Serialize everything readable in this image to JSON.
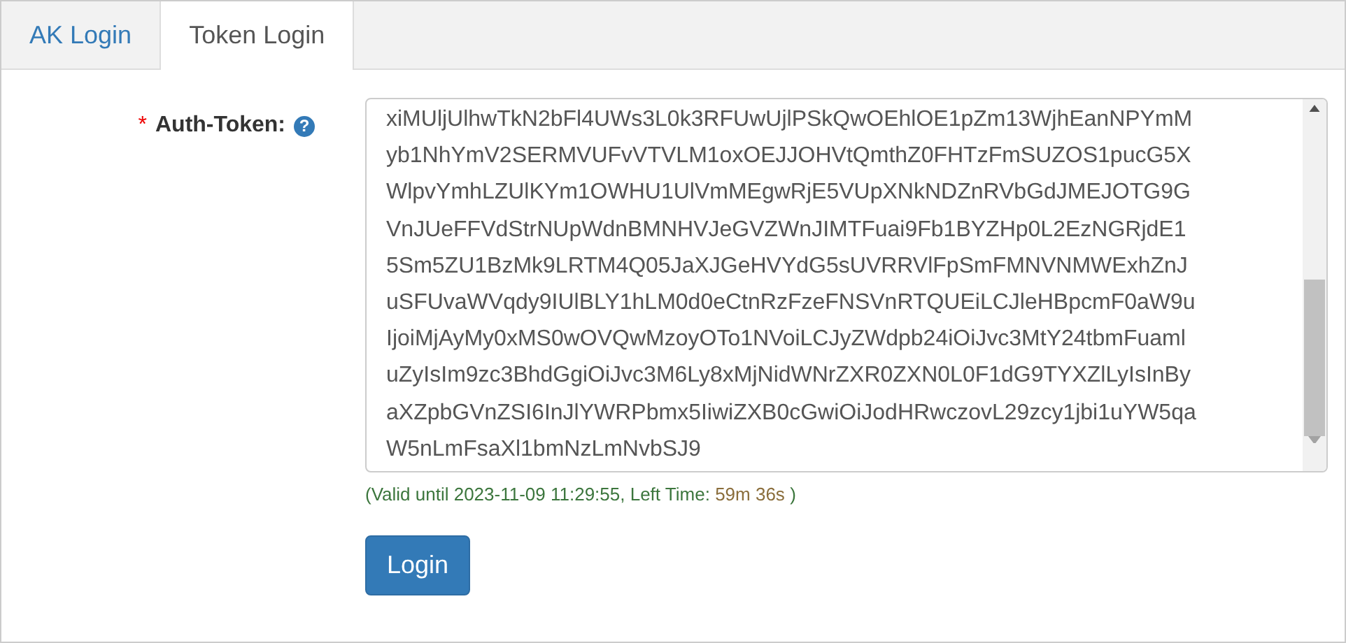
{
  "tabs": [
    {
      "label": "AK Login",
      "selected": false
    },
    {
      "label": "Token Login",
      "selected": true
    }
  ],
  "form": {
    "required_mark": "*",
    "label": "Auth-Token:",
    "help_icon": "?",
    "token_lines": [
      "xiMUljUlhwTkN2bFl4UWs3L0k3RFUwUjlPSkQwOEhlOE1pZm13WjhEanNPYmM",
      "yb1NhYmV2SERMVUFvVTVLM1oxOEJJOHVtQmthZ0FHTzFmSUZOS1pucG5X",
      "WlpvYmhLZUlKYm1OWHU1UlVmMEgwRjE5VUpXNkNDZnRVbGdJMEJOTG9G",
      "VnJUeFFVdStrNUpWdnBMNHVJeGVZWnJIMTFuai9Fb1BYZHp0L2EzNGRjdE1",
      "5Sm5ZU1BzMk9LRTM4Q05JaXJGeHVYdG5sUVRRVlFpSmFMNVNMWExhZnJ",
      "uSFUvaWVqdy9IUlBLY1hLM0d0eCtnRzFzeFNSVnRTQUEiLCJleHBpcmF0aW9u",
      "IjoiMjAyMy0xMS0wOVQwMzoyOTo1NVoiLCJyZWdpb24iOiJvc3MtY24tbmFuaml",
      "uZyIsIm9zc3BhdGgiOiJvc3M6Ly8xMjNidWNrZXR0ZXN0L0F1dG9TYXZlLyIsInBy",
      "aXZpbGVnZSI6InJlYWRPbmx5IiwiZXB0cGwiOiJodHRwczovL29zcy1jbi1uYW5qa",
      "W5nLmFsaXl1bmNzLmNvbSJ9"
    ],
    "validity_text": "(Valid until 2023-11-09 11:29:55, Left Time:",
    "time_left": "59m 36s",
    "validity_end": ")",
    "button": "Login"
  }
}
